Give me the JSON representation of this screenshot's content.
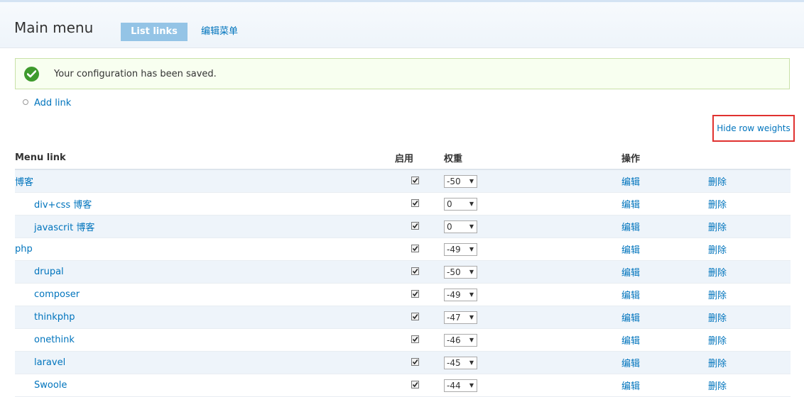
{
  "header": {
    "title": "Main menu",
    "tabs": {
      "list_links": "List links",
      "edit_menu": "编辑菜单"
    }
  },
  "message": {
    "text": "Your configuration has been saved."
  },
  "actions": {
    "add_link": "Add link",
    "hide_row_weights": "Hide row weights"
  },
  "table": {
    "headers": {
      "menu_link": "Menu link",
      "enabled": "启用",
      "weight": "权重",
      "operations": "操作"
    },
    "edit_label": "编辑",
    "delete_label": "删除",
    "rows": [
      {
        "title": "博客",
        "enabled": true,
        "weight": "-50",
        "indent": 0
      },
      {
        "title": "div+css 博客",
        "enabled": true,
        "weight": "0",
        "indent": 1
      },
      {
        "title": "javascrit 博客",
        "enabled": true,
        "weight": "0",
        "indent": 1
      },
      {
        "title": "php",
        "enabled": true,
        "weight": "-49",
        "indent": 0
      },
      {
        "title": "drupal",
        "enabled": true,
        "weight": "-50",
        "indent": 1
      },
      {
        "title": "composer",
        "enabled": true,
        "weight": "-49",
        "indent": 1
      },
      {
        "title": "thinkphp",
        "enabled": true,
        "weight": "-47",
        "indent": 1
      },
      {
        "title": "onethink",
        "enabled": true,
        "weight": "-46",
        "indent": 1
      },
      {
        "title": "laravel",
        "enabled": true,
        "weight": "-45",
        "indent": 1
      },
      {
        "title": "Swoole",
        "enabled": true,
        "weight": "-44",
        "indent": 1
      }
    ]
  },
  "colors": {
    "link": "#0074bd",
    "tab_active_bg": "#94c4e6",
    "status_ok": "#3e9a2d",
    "highlight_box": "#e0312f"
  }
}
